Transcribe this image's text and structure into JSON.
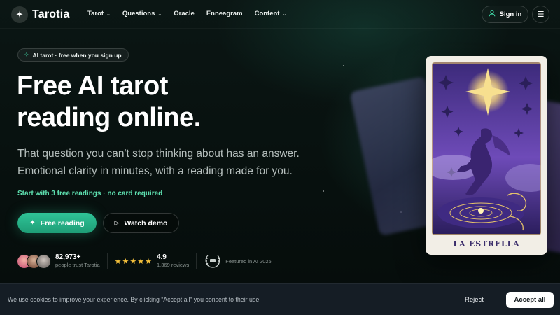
{
  "brand": {
    "name": "Tarotia",
    "logo_icon": "sparkle-icon"
  },
  "nav": {
    "items": [
      {
        "label": "Tarot",
        "has_dropdown": true
      },
      {
        "label": "Questions",
        "has_dropdown": true
      },
      {
        "label": "Oracle",
        "has_dropdown": false
      },
      {
        "label": "Enneagram",
        "has_dropdown": false
      },
      {
        "label": "Content",
        "has_dropdown": true
      }
    ],
    "signin_label": "Sign in",
    "menu_icon": "hamburger-icon"
  },
  "hero": {
    "badge": "AI tarot · free when you sign up",
    "title_line1": "Free AI tarot",
    "title_line2": "reading online.",
    "subtitle_line1": "That question you can't stop thinking about has an answer.",
    "subtitle_line2": "Emotional clarity in minutes, with a reading made for you.",
    "free_note": "Start with 3 free readings · no card required",
    "primary_cta": "Free reading",
    "secondary_cta": "Watch demo"
  },
  "social_proof": {
    "users_count": "82,973+",
    "users_caption": "people trust Tarotia",
    "rating": "4.9",
    "rating_stars": 5,
    "reviews": "1,369 reviews",
    "featured": "Featured in AI 2025"
  },
  "card": {
    "name": "LA ESTRELLA"
  },
  "cookie": {
    "text": "We use cookies to improve your experience. By clicking “Accept all” you consent to their use.",
    "reject_label": "Reject",
    "accept_label": "Accept all"
  },
  "colors": {
    "accent": "#2fc497",
    "accent_text": "#5ee0b0",
    "star": "#f5c13b",
    "background": "#07110f",
    "card_purple": "#5b3ea0"
  }
}
